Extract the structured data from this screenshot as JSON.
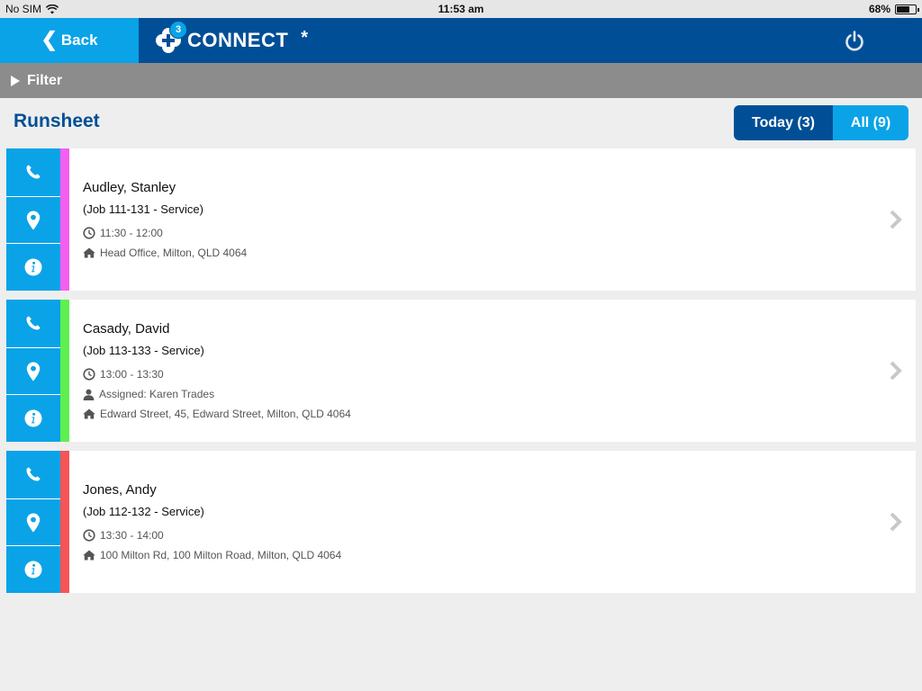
{
  "status_bar": {
    "carrier": "No SIM",
    "time": "11:53 am",
    "battery_text": "68%",
    "battery_level": 0.68
  },
  "header": {
    "back_label": "Back",
    "logo_badge": "3",
    "app_name": "CONNECT",
    "app_suffix": "*"
  },
  "filter": {
    "label": "Filter"
  },
  "page": {
    "title": "Runsheet"
  },
  "segments": {
    "today": "Today (3)",
    "all": "All (9)"
  },
  "colors": {
    "primary": "#004f96",
    "accent": "#0aa3e8"
  },
  "jobs": [
    {
      "name": "Audley, Stanley",
      "job": "(Job 111-131 - Service)",
      "time": "11:30 - 12:00",
      "assigned": null,
      "address": "Head Office, Milton, QLD 4064",
      "color": "#f55ff0"
    },
    {
      "name": "Casady, David",
      "job": "(Job 113-133 - Service)",
      "time": "13:00 - 13:30",
      "assigned": "Assigned: Karen Trades",
      "address": "Edward Street, 45, Edward Street, Milton, QLD 4064",
      "color": "#5ef04f"
    },
    {
      "name": "Jones, Andy",
      "job": "(Job 112-132 - Service)",
      "time": "13:30 - 14:00",
      "assigned": null,
      "address": "100 Milton Rd, 100 Milton Road, Milton, QLD 4064",
      "color": "#f55555"
    }
  ]
}
